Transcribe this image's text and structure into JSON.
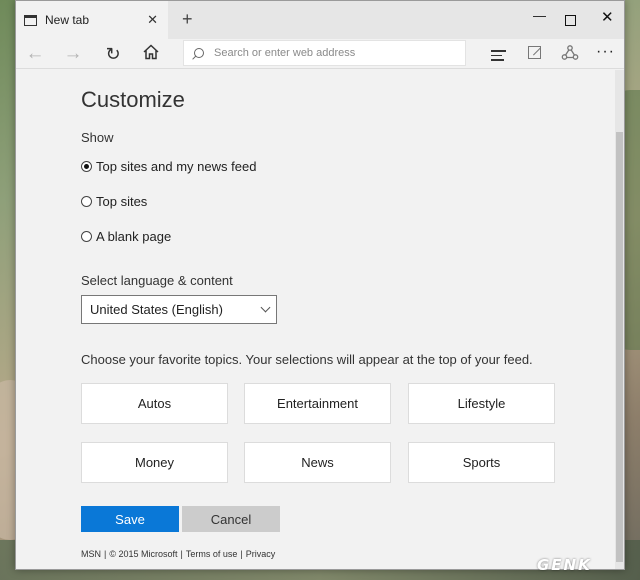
{
  "browser": {
    "tab_title": "New tab",
    "tab_close_glyph": "✕",
    "new_tab_glyph": "+",
    "window_controls": {
      "minimize": "—",
      "close": "✕"
    },
    "toolbar": {
      "back_glyph": "←",
      "forward_glyph": "→",
      "refresh_glyph": "↻",
      "home_glyph": "⌂",
      "address_placeholder": "Search or enter web address",
      "more_glyph": "···"
    }
  },
  "customize": {
    "title": "Customize",
    "show_label": "Show",
    "show_options": [
      {
        "label": "Top sites and my news feed",
        "checked": true
      },
      {
        "label": "Top sites",
        "checked": false
      },
      {
        "label": "A blank page",
        "checked": false
      }
    ],
    "language_label": "Select language & content",
    "language_value": "United States (English)",
    "topics_label": "Choose your favorite topics. Your selections will appear at the top of your feed.",
    "topics": [
      "Autos",
      "Entertainment",
      "Lifestyle",
      "Money",
      "News",
      "Sports"
    ],
    "save_label": "Save",
    "cancel_label": "Cancel",
    "footer": {
      "msn": "MSN",
      "sep": "|",
      "copyright": "© 2015 Microsoft",
      "terms": "Terms of use",
      "privacy": "Privacy"
    }
  },
  "colors": {
    "accent": "#0a78d7",
    "page_bg": "#f2f2f2"
  },
  "watermark": "GENK"
}
